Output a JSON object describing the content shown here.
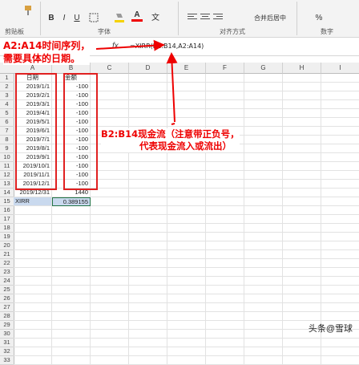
{
  "ribbon": {
    "paste_icon": "brush-icon",
    "bold": "B",
    "italic": "I",
    "underline": "U",
    "font_color_glyph": "A",
    "change_glyph": "文",
    "percent": "%",
    "merge_center": "合并后居中",
    "groups": {
      "clipboard": "剪贴板",
      "font": "字体",
      "alignment": "对齐方式",
      "number": "数字"
    }
  },
  "formula_bar": {
    "fx": "fx",
    "formula": "=XIRR(B2:B14,A2:A14)"
  },
  "columns": [
    "A",
    "B",
    "C",
    "D",
    "E",
    "F",
    "G",
    "H",
    "I"
  ],
  "rows": [
    "1",
    "2",
    "3",
    "4",
    "5",
    "6",
    "7",
    "8",
    "9",
    "10",
    "11",
    "12",
    "13",
    "14",
    "15",
    "16",
    "17",
    "18",
    "19",
    "20",
    "21",
    "22",
    "23",
    "24",
    "25",
    "26",
    "27",
    "28",
    "29",
    "30",
    "31",
    "32",
    "33"
  ],
  "table": {
    "header": [
      "日期",
      "金额"
    ],
    "data": [
      [
        "2019/1/1",
        "-100"
      ],
      [
        "2019/2/1",
        "-100"
      ],
      [
        "2019/3/1",
        "-100"
      ],
      [
        "2019/4/1",
        "-100"
      ],
      [
        "2019/5/1",
        "-100"
      ],
      [
        "2019/6/1",
        "-100"
      ],
      [
        "2019/7/1",
        "-100"
      ],
      [
        "2019/8/1",
        "-100"
      ],
      [
        "2019/9/1",
        "-100"
      ],
      [
        "2019/10/1",
        "-100"
      ],
      [
        "2019/11/1",
        "-100"
      ],
      [
        "2019/12/1",
        "-100"
      ],
      [
        "2019/12/31",
        "1440"
      ]
    ],
    "result_label": "XIRR",
    "result_value": "0.389155"
  },
  "annotations": {
    "a_line1": "A2:A14时间序列，",
    "a_line2": "需要具体的日期。",
    "b_line1": "B2:B14现金流（注意带正负号，",
    "b_line2": "代表现金流入或流出）"
  },
  "colors": {
    "annotation": "#e00000",
    "box": "#e02020",
    "selected": "#c9d9ee"
  },
  "watermark": "头条@雪球"
}
